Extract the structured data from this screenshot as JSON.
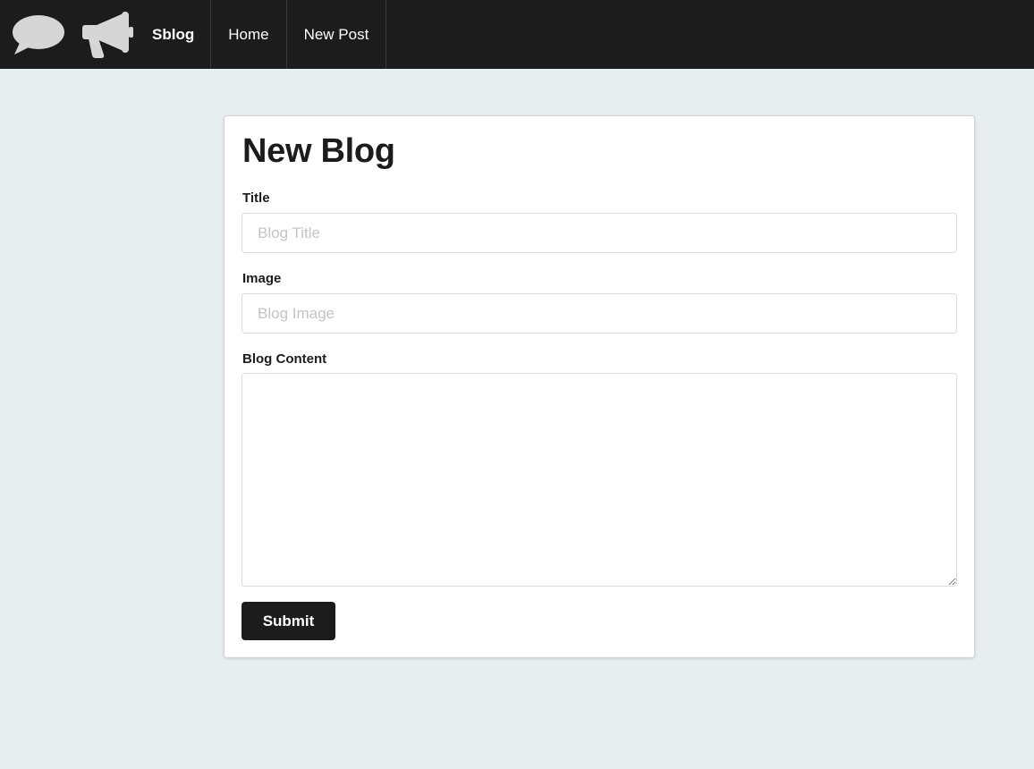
{
  "navbar": {
    "icons": [
      "chat-bubble-icon",
      "megaphone-icon"
    ],
    "brand": "Sblog",
    "items": [
      {
        "label": "Home"
      },
      {
        "label": "New Post"
      }
    ],
    "icon_color": "#d6d6d6",
    "background": "#1b1c1d"
  },
  "form": {
    "title": "New Blog",
    "fields": {
      "title": {
        "label": "Title",
        "placeholder": "Blog Title",
        "value": ""
      },
      "image": {
        "label": "Image",
        "placeholder": "Blog Image",
        "value": ""
      },
      "content": {
        "label": "Blog Content",
        "value": ""
      }
    },
    "submit_label": "Submit"
  },
  "colors": {
    "page_background": "#e6eef0",
    "card_background": "#ffffff",
    "primary_button": "#1b1c1d"
  }
}
